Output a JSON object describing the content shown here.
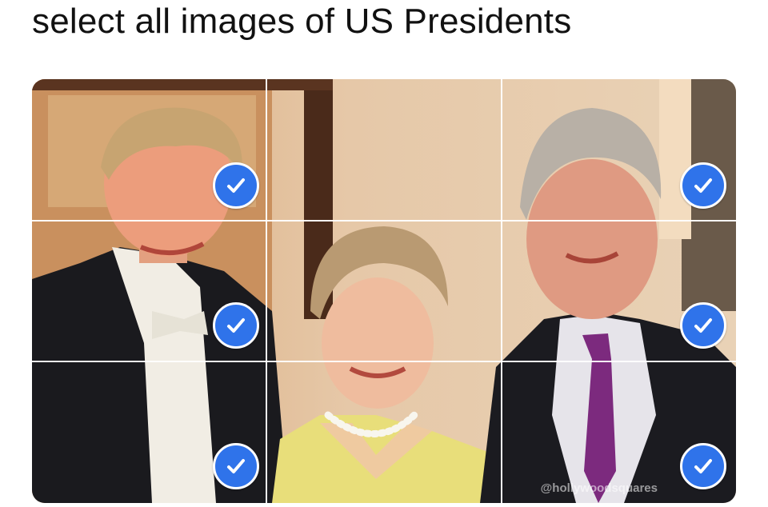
{
  "prompt": {
    "text": "select all images of US Presidents"
  },
  "grid": {
    "rows": 3,
    "columns": 3,
    "tiles": [
      {
        "row": 1,
        "col": 1,
        "selected": true
      },
      {
        "row": 1,
        "col": 2,
        "selected": false
      },
      {
        "row": 1,
        "col": 3,
        "selected": true
      },
      {
        "row": 2,
        "col": 1,
        "selected": true
      },
      {
        "row": 2,
        "col": 2,
        "selected": false
      },
      {
        "row": 2,
        "col": 3,
        "selected": true
      },
      {
        "row": 3,
        "col": 1,
        "selected": true
      },
      {
        "row": 3,
        "col": 2,
        "selected": false
      },
      {
        "row": 3,
        "col": 3,
        "selected": true
      }
    ]
  },
  "watermark": "@hollywoodsquares",
  "colors": {
    "check_fill": "#2f73ea",
    "check_border": "#ffffff",
    "grid_lines": "#ffffff",
    "title_text": "#111111"
  },
  "icons": {
    "selected_marker": "checkmark-icon"
  }
}
